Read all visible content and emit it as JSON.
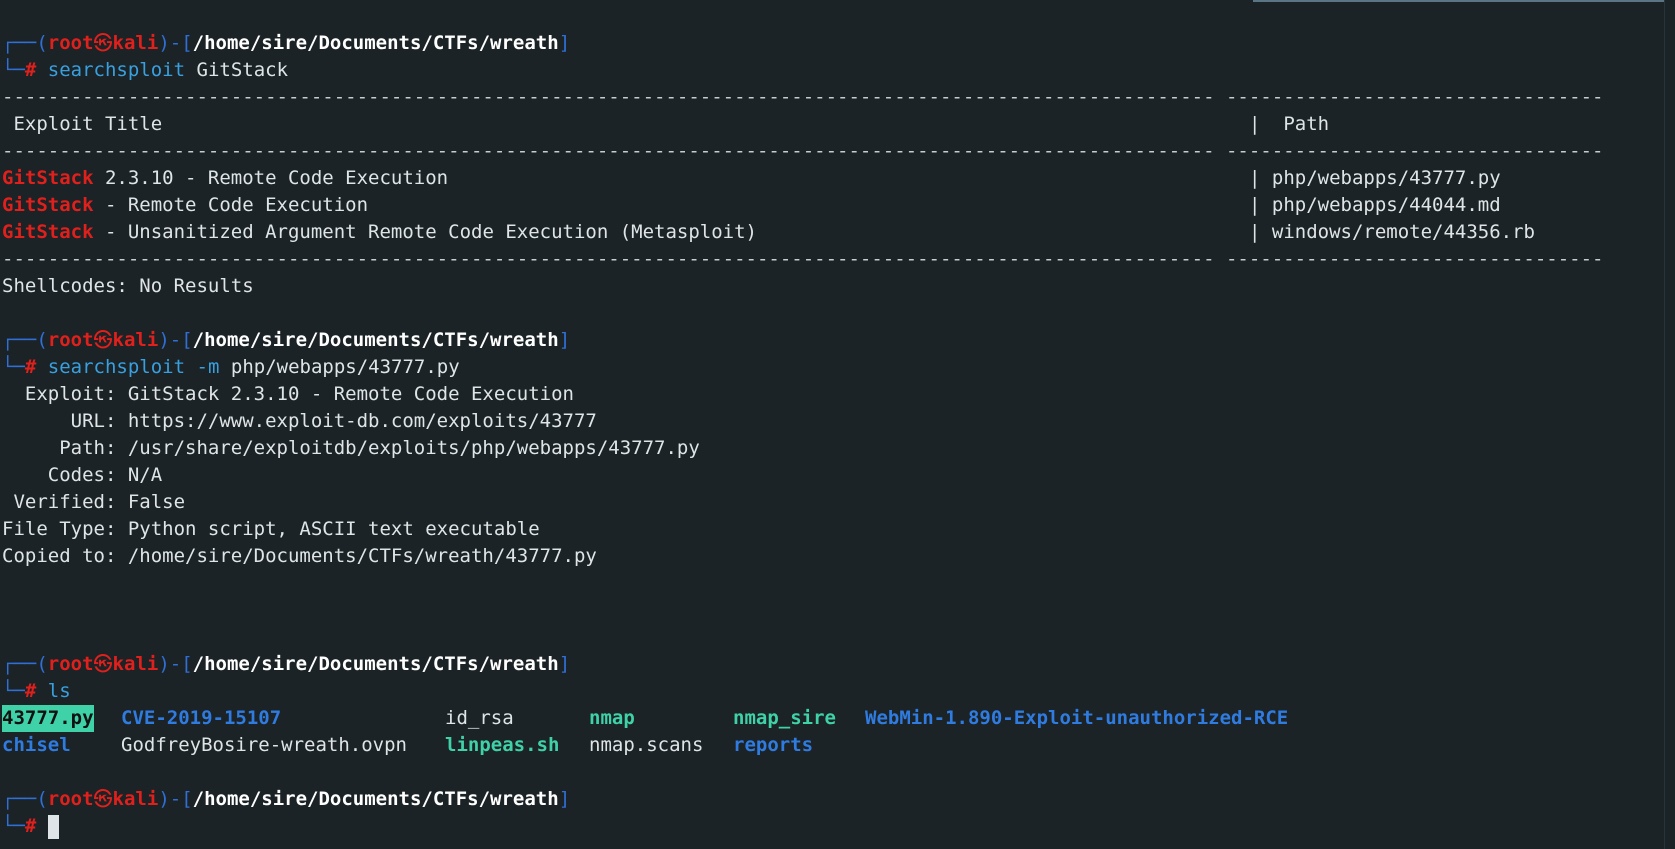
{
  "prompt": {
    "user": "root",
    "skull": "㉿",
    "host": "kali",
    "path": "/home/sire/Documents/CTFs/wreath"
  },
  "commands": {
    "c1_name": "searchsploit",
    "c1_arg": "GitStack",
    "c2_name": "searchsploit",
    "c2_flag": "-m",
    "c2_arg": "php/webapps/43777.py",
    "c3_name": "ls"
  },
  "results_table": {
    "divider": "---------------------------------------------------------------------------------------------------------- ---------------------------------",
    "header_title": " Exploit Title",
    "header_path": "|  Path",
    "rows": [
      {
        "keyword": "GitStack",
        "rest": " 2.3.10 - Remote Code Execution",
        "path": "| php/webapps/43777.py"
      },
      {
        "keyword": "GitStack",
        "rest": " - Remote Code Execution",
        "path": "| php/webapps/44044.md"
      },
      {
        "keyword": "GitStack",
        "rest": " - Unsanitized Argument Remote Code Execution (Metasploit)",
        "path": "| windows/remote/44356.rb"
      }
    ],
    "shellcodes": "Shellcodes: No Results"
  },
  "mirror_output": [
    "  Exploit: GitStack 2.3.10 - Remote Code Execution",
    "      URL: https://www.exploit-db.com/exploits/43777",
    "     Path: /usr/share/exploitdb/exploits/php/webapps/43777.py",
    "    Codes: N/A",
    " Verified: False",
    "File Type: Python script, ASCII text executable",
    "Copied to: /home/sire/Documents/CTFs/wreath/43777.py"
  ],
  "ls_output": {
    "row1": [
      "43777.py",
      "CVE-2019-15107",
      "id_rsa",
      "nmap",
      "nmap_sire",
      "WebMin-1.890-Exploit-unauthorized-RCE"
    ],
    "row2": [
      "chisel",
      "GodfreyBosire-wreath.ovpn",
      "linpeas.sh",
      "nmap.scans",
      "reports"
    ]
  },
  "colors": {
    "background": "#1b2326",
    "prompt_frame": "#2f6fd6",
    "root_user": "#e0201c",
    "command": "#39a0e0",
    "executable": "#3fd1a8",
    "directory": "#2f7be0"
  }
}
